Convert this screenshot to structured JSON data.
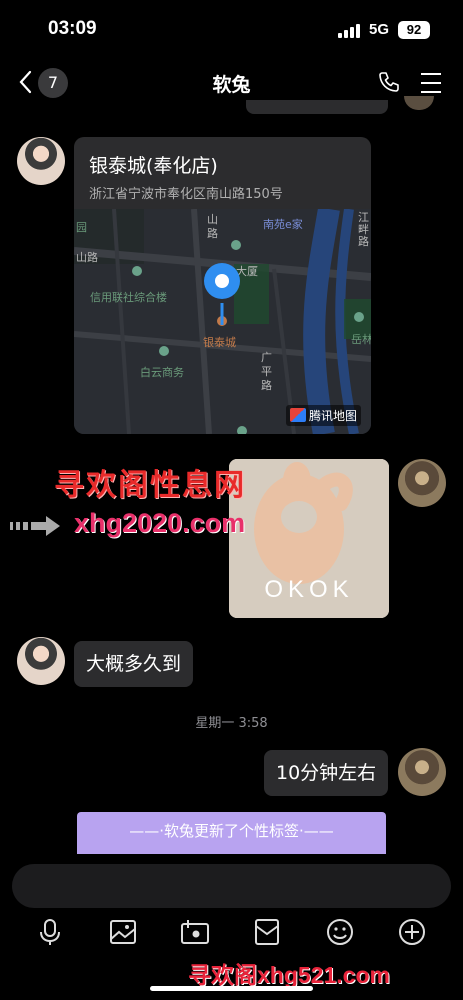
{
  "status_bar": {
    "time": "03:09",
    "network": "5G",
    "battery": "92"
  },
  "nav": {
    "back_count": "7",
    "title": "软兔",
    "icons": [
      "phone-icon",
      "menu-icon"
    ]
  },
  "messages": {
    "location": {
      "name": "银泰城(奉化店)",
      "address": "浙江省宁波市奉化区南山路150号",
      "map_labels": {
        "yuan": "园",
        "shanlu_v": "山\n路",
        "nanyuan": "南苑e家",
        "jiangpan": "江\n畔\n路",
        "shanlu_h": "山路",
        "dasha": "大厦",
        "xinyong": "信用联社综合楼",
        "yintai": "银泰城",
        "yuelin": "岳林文",
        "baiyun": "白云商务",
        "guangping": "广\n平\n路"
      },
      "map_brand": "腾讯地图"
    },
    "image_caption": "OKOK",
    "text_left": "大概多久到",
    "timestamp": "星期一 3:58",
    "text_right": "10分钟左右",
    "system_notice": "——·软兔更新了个性标签·——"
  },
  "watermarks": {
    "line1": "寻欢阁性息网",
    "line2": "xhg2020.com",
    "bottom": "寻欢阁xhg521.com"
  },
  "toolbar": [
    "microphone-icon",
    "image-icon",
    "camera-icon",
    "envelope-icon",
    "emoji-icon",
    "plus-icon"
  ],
  "colors": {
    "background": "#000000",
    "bubble": "#2c2c2e",
    "system_notice": "#b8a3f0",
    "watermark": "#e82a2a"
  }
}
